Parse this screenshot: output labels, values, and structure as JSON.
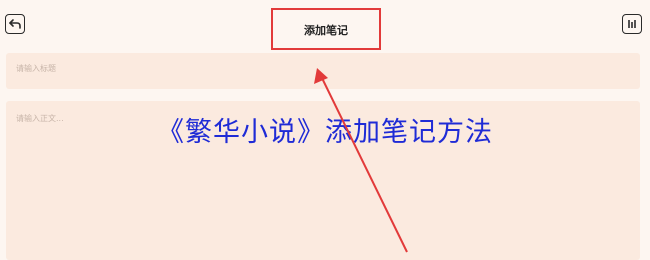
{
  "header": {
    "title": "添加笔记",
    "back_icon": "back-arrow-icon",
    "save_icon": "save-bars-icon"
  },
  "form": {
    "title_placeholder": "请输入标题",
    "body_placeholder": "请输入正文..."
  },
  "overlay": {
    "caption": "《繁华小说》添加笔记方法",
    "caption_color": "#1f2bd6",
    "highlight_color": "#e23a3a"
  },
  "colors": {
    "background": "#fdf6f1",
    "field": "#fbeadf"
  }
}
